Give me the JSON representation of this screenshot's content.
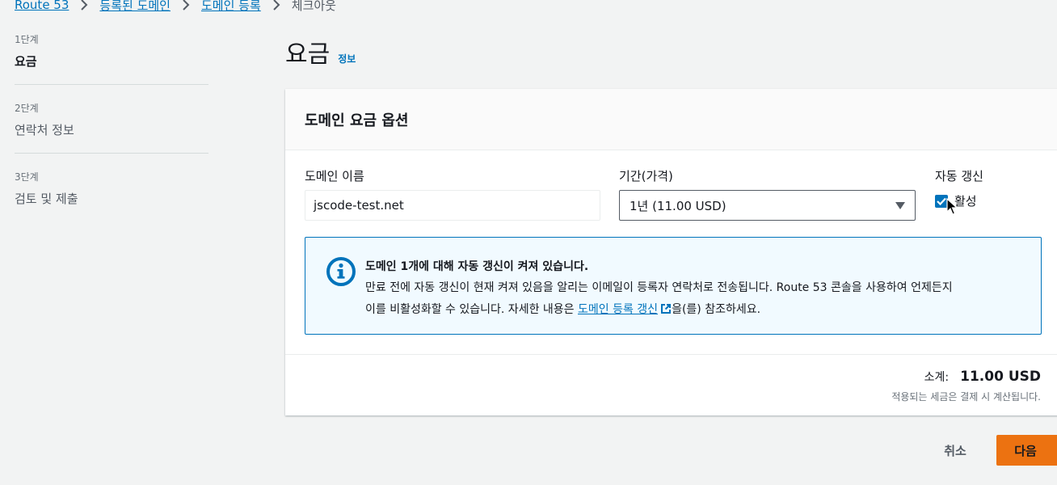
{
  "breadcrumb": {
    "items": [
      "Route 53",
      "등록된 도메인",
      "도메인 등록"
    ],
    "current": "체크아웃"
  },
  "steps": [
    {
      "number": "1단계",
      "title": "요금"
    },
    {
      "number": "2단계",
      "title": "연락처 정보"
    },
    {
      "number": "3단계",
      "title": "검토 및 제출"
    }
  ],
  "page": {
    "title": "요금",
    "info_link": "정보"
  },
  "panel": {
    "title": "도메인 요금 옵션",
    "domain_label": "도메인 이름",
    "domain_value": "jscode-test.net",
    "period_label": "기간(가격)",
    "period_value": "1년 (11.00 USD)",
    "auto_renew_label": "자동 갱신",
    "auto_renew_option": "활성",
    "auto_renew_checked": true
  },
  "alert": {
    "title": "도메인 1개에 대해 자동 갱신이 켜져 있습니다.",
    "line1": "만료 전에 자동 갱신이 현재 켜져 있음을 알리는 이메일이 등록자 연락처로 전송됩니다. Route 53 콘솔을 사용하여 언제든지",
    "line2_prefix": "이를 비활성화할 수 있습니다. 자세한 내용은 ",
    "link": "도메인 등록 갱신",
    "line2_suffix": "을(를) 참조하세요."
  },
  "summary": {
    "subtotal_label": "소계:",
    "subtotal_value": "11.00 USD",
    "tax_note": "적용되는 세금은 결제 시 계산됩니다."
  },
  "actions": {
    "cancel": "취소",
    "next": "다음"
  },
  "colors": {
    "link": "#0073bb",
    "primary_button": "#ec7211",
    "alert_bg": "#f1faff"
  }
}
